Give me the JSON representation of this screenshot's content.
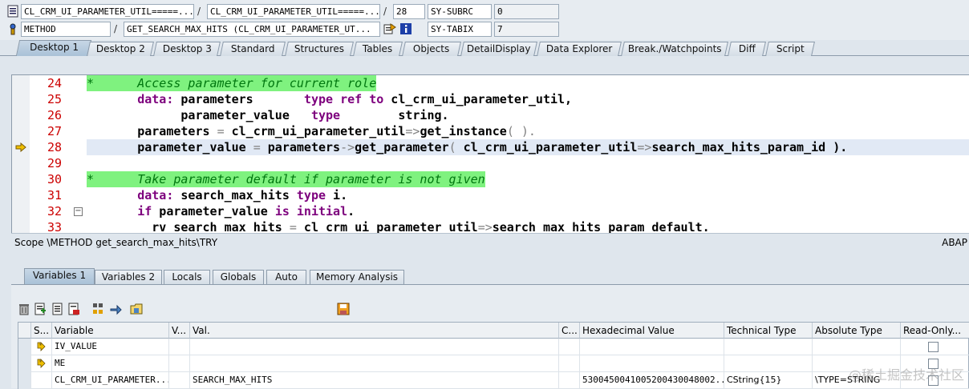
{
  "header": {
    "row1": {
      "field1": "CL_CRM_UI_PARAMETER_UTIL=====...",
      "sep1": "/",
      "field2": "CL_CRM_UI_PARAMETER_UTIL=====...",
      "sep2": "/",
      "line": "28",
      "sysvar": "SY-SUBRC",
      "sysval": "0"
    },
    "row2": {
      "field1": "METHOD",
      "sep1": "/",
      "field2": "GET_SEARCH_MAX_HITS (CL_CRM_UI_PARAMETER_UT...",
      "sysvar": "SY-TABIX",
      "sysval": "7"
    }
  },
  "desktop_tabs": [
    "Desktop 1",
    "Desktop 2",
    "Desktop 3",
    "Standard",
    "Structures",
    "Tables",
    "Objects",
    "DetailDisplay",
    "Data Explorer",
    "Break./Watchpoints",
    "Diff",
    "Script"
  ],
  "editor": {
    "lines": [
      {
        "num": "24"
      },
      {
        "num": "25"
      },
      {
        "num": "26"
      },
      {
        "num": "27"
      },
      {
        "num": "28"
      },
      {
        "num": "29"
      },
      {
        "num": "30"
      },
      {
        "num": "31"
      },
      {
        "num": "32"
      },
      {
        "num": "33"
      }
    ],
    "code": {
      "l24": "*      Access parameter for current role",
      "l25a": "       data: ",
      "l25b": "parameters       ",
      "l25c": "type ref to",
      "l25d": " cl_crm_ui_parameter_util,",
      "l26a": "             parameter_value   ",
      "l26b": "type",
      "l26c": "        string.",
      "l27a": "       parameters ",
      "l27b": "=",
      "l27c": " cl_crm_ui_parameter_util",
      "l27d": "=>",
      "l27e": "get_instance",
      "l27f": "( ).",
      "l28a": "       parameter_value ",
      "l28b": "=",
      "l28c": " parameters",
      "l28d": "->",
      "l28e": "get_parameter",
      "l28f": "( ",
      "l28g": "cl_crm_ui_parameter_util",
      "l28h": "=>",
      "l28i": "search_max_hits_param_id ).",
      "l30": "*      Take parameter default if parameter is not given",
      "l31a": "       data: ",
      "l31b": "search_max_hits ",
      "l31c": "type",
      "l31d": " i.",
      "l32a": "       if",
      "l32b": " parameter_value ",
      "l32c": "is initial",
      "l32d": ".",
      "l33a": "         rv_search_max_hits ",
      "l33b": "=",
      "l33c": " cl_crm_ui_parameter_util",
      "l33d": "=>",
      "l33e": "search_max_hits_param_default."
    }
  },
  "status": {
    "scope": "Scope \\METHOD get_search_max_hits\\TRY",
    "lang": "ABAP"
  },
  "var_tabs": [
    "Variables 1",
    "Variables 2",
    "Locals",
    "Globals",
    "Auto",
    "Memory Analysis"
  ],
  "grid": {
    "headers": [
      "S...",
      "Variable",
      "V...",
      "Val.",
      "C...",
      "Hexadecimal Value",
      "Technical Type",
      "Absolute Type",
      "Read-Only..."
    ],
    "rows": [
      {
        "variable": "IV_VALUE",
        "val": "",
        "hex": "",
        "tech": "",
        "abs": ""
      },
      {
        "variable": "ME",
        "val": "",
        "hex": "",
        "tech": "",
        "abs": ""
      },
      {
        "variable": "CL_CRM_UI_PARAMETER...",
        "val": "SEARCH_MAX_HITS",
        "hex": "5300450041005200430048002...",
        "tech": "CString{15}",
        "abs": "\\TYPE=STRING"
      }
    ]
  },
  "watermark": "@稀土掘金技术社区",
  "colors": {
    "accent": "#a9c1d7",
    "comment_bg": "#7ff27f",
    "linenum": "#cc0000",
    "keyword": "#7d007d"
  }
}
